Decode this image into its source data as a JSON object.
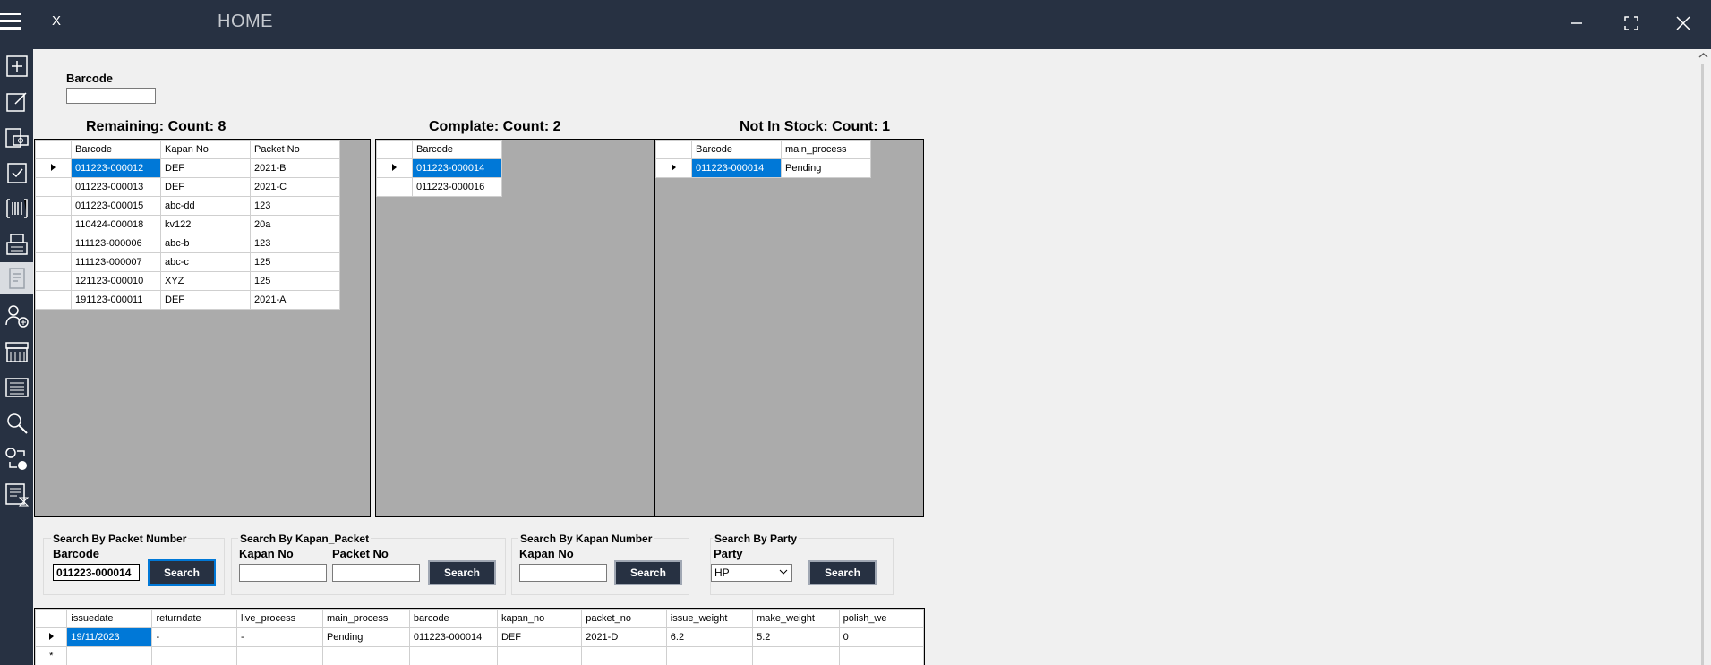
{
  "window": {
    "title": "HOME",
    "close_label": "X"
  },
  "barcode": {
    "label": "Barcode",
    "value": ""
  },
  "remaining": {
    "title": "Remaining:  Count: 8",
    "columns": [
      "Barcode",
      "Kapan No",
      "Packet No"
    ],
    "rows": [
      [
        "011223-000012",
        "DEF",
        "2021-B"
      ],
      [
        "011223-000013",
        "DEF",
        "2021-C"
      ],
      [
        "011223-000015",
        "abc-dd",
        "123"
      ],
      [
        "110424-000018",
        "kv122",
        "20a"
      ],
      [
        "111123-000006",
        "abc-b",
        "123"
      ],
      [
        "111123-000007",
        "abc-c",
        "125"
      ],
      [
        "121123-000010",
        "XYZ",
        "125"
      ],
      [
        "191123-000011",
        "DEF",
        "2021-A"
      ]
    ]
  },
  "complate": {
    "title": "Complate:  Count: 2",
    "columns": [
      "Barcode"
    ],
    "rows": [
      [
        "011223-000014"
      ],
      [
        "011223-000016"
      ]
    ]
  },
  "not_in_stock": {
    "title": "Not In Stock: Count: 1",
    "columns": [
      "Barcode",
      "main_process"
    ],
    "rows": [
      [
        "011223-000014",
        "Pending"
      ]
    ]
  },
  "search_packet": {
    "group": "Search By Packet Number",
    "label": "Barcode",
    "value": "011223-000014",
    "button": "Search"
  },
  "search_kapan_packet": {
    "group": "Search By Kapan_Packet",
    "kapan_label": "Kapan No",
    "packet_label": "Packet No",
    "button": "Search"
  },
  "search_kapan": {
    "group": "Search By Kapan Number",
    "label": "Kapan No",
    "button": "Search"
  },
  "search_party": {
    "group": "Search By Party",
    "label": "Party",
    "selected": "HP",
    "button": "Search"
  },
  "details": {
    "columns": [
      "issuedate",
      "returndate",
      "live_process",
      "main_process",
      "barcode",
      "kapan_no",
      "packet_no",
      "issue_weight",
      "make_weight",
      "polish_we"
    ],
    "rows": [
      [
        "19/11/2023",
        "-",
        "-",
        "Pending",
        "011223-000014",
        "DEF",
        "2021-D",
        "6.2",
        "5.2",
        "0"
      ]
    ],
    "new_row_marker": "*"
  },
  "colors": {
    "titlebar": "#273142",
    "selection": "#0078d7",
    "grid_bg": "#ababab"
  }
}
